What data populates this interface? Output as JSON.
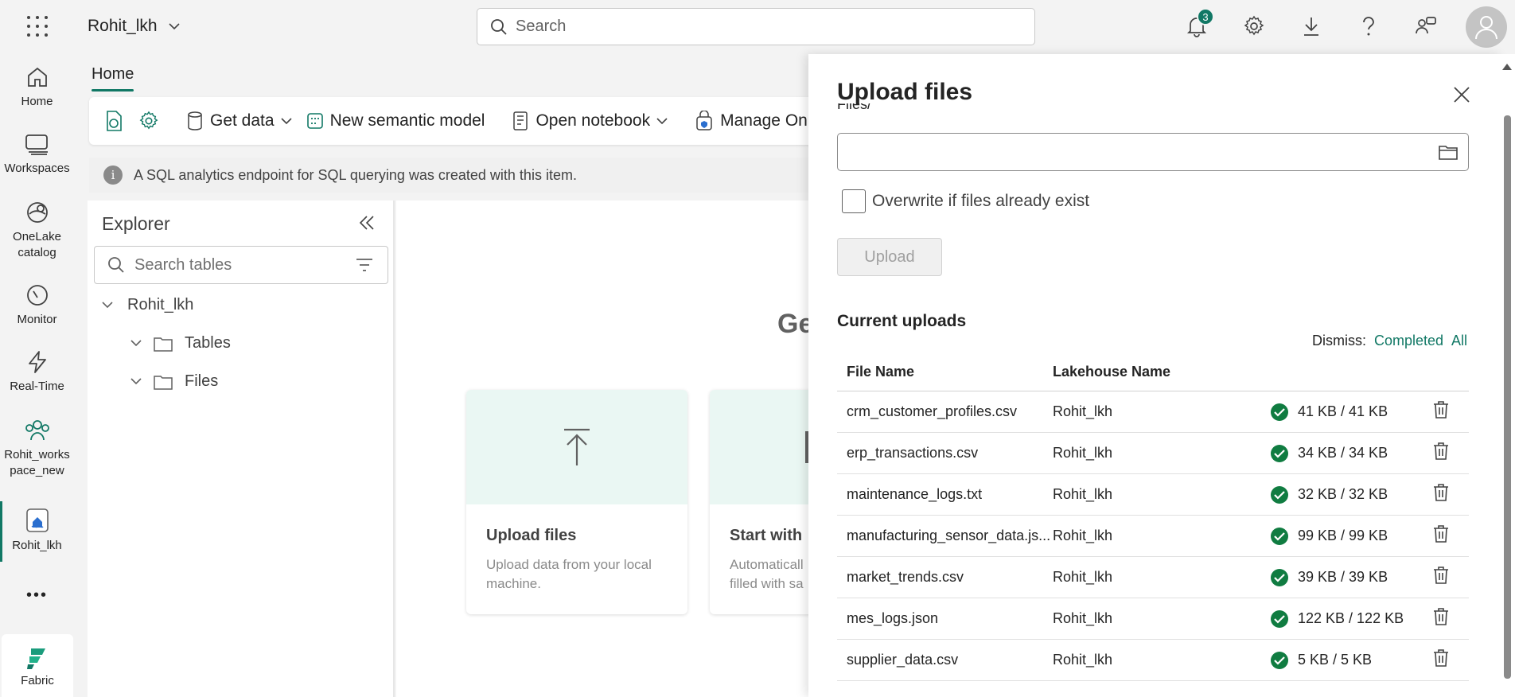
{
  "topbar": {
    "workspace_name": "Rohit_lkh",
    "search_placeholder": "Search",
    "notification_count": "3"
  },
  "rail": {
    "items": [
      {
        "label": "Home",
        "icon": "home-icon"
      },
      {
        "label": "Workspaces",
        "icon": "workspaces-icon"
      },
      {
        "label": "OneLake catalog",
        "icon": "onelake-icon"
      },
      {
        "label": "Monitor",
        "icon": "monitor-icon"
      },
      {
        "label": "Real-Time",
        "icon": "lightning-icon"
      },
      {
        "label": "Rohit_workspace_new",
        "icon": "workspace-people-icon"
      },
      {
        "label": "Rohit_lkh",
        "icon": "lakehouse-icon"
      }
    ],
    "more": "•••",
    "fabric_label": "Fabric"
  },
  "main": {
    "home_tab": "Home",
    "ribbon": {
      "get_data": "Get data",
      "new_semantic_model": "New semantic model",
      "open_notebook": "Open notebook",
      "manage": "Manage On"
    },
    "info": "A SQL analytics endpoint for SQL querying was created with this item.",
    "get_started_partial": "Ge",
    "cards": [
      {
        "title": "Upload files",
        "desc": "Upload data from your local machine."
      },
      {
        "title": "Start with",
        "desc": "Automaticall filled with sa"
      }
    ]
  },
  "explorer": {
    "title": "Explorer",
    "search_placeholder": "Search tables",
    "root": "Rohit_lkh",
    "nodes": [
      "Tables",
      "Files"
    ]
  },
  "panel": {
    "title": "Upload files",
    "files_label": "Files/",
    "overwrite_label": "Overwrite if files already exist",
    "upload_button": "Upload",
    "current_uploads": "Current uploads",
    "dismiss_label": "Dismiss:",
    "dismiss_completed": "Completed",
    "dismiss_all": "All",
    "col_file": "File Name",
    "col_lakehouse": "Lakehouse Name",
    "rows": [
      {
        "file": "crm_customer_profiles.csv",
        "lakehouse": "Rohit_lkh",
        "size": "41 KB / 41 KB"
      },
      {
        "file": "erp_transactions.csv",
        "lakehouse": "Rohit_lkh",
        "size": "34 KB / 34 KB"
      },
      {
        "file": "maintenance_logs.txt",
        "lakehouse": "Rohit_lkh",
        "size": "32 KB / 32 KB"
      },
      {
        "file": "manufacturing_sensor_data.js...",
        "lakehouse": "Rohit_lkh",
        "size": "99 KB / 99 KB"
      },
      {
        "file": "market_trends.csv",
        "lakehouse": "Rohit_lkh",
        "size": "39 KB / 39 KB"
      },
      {
        "file": "mes_logs.json",
        "lakehouse": "Rohit_lkh",
        "size": "122 KB / 122 KB"
      },
      {
        "file": "supplier_data.csv",
        "lakehouse": "Rohit_lkh",
        "size": "5 KB / 5 KB"
      }
    ]
  },
  "colors": {
    "accent": "#117865",
    "success": "#107c41"
  }
}
